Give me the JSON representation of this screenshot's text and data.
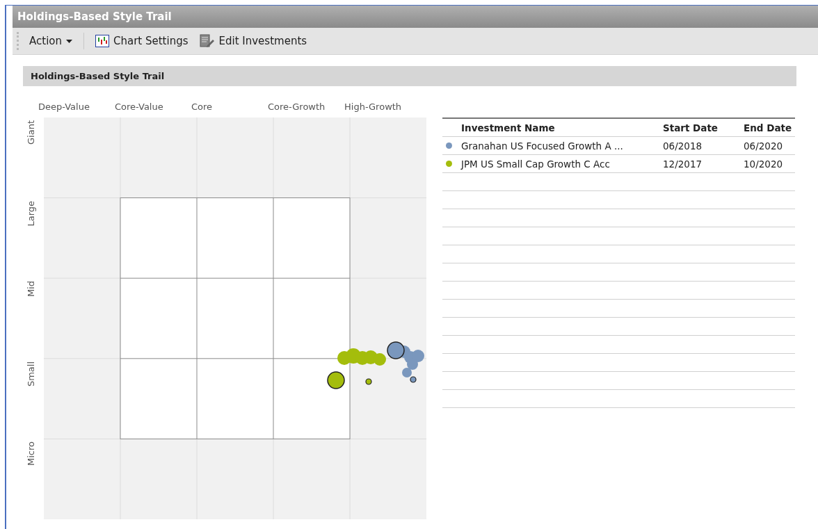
{
  "window": {
    "title": "Holdings-Based Style Trail"
  },
  "toolbar": [
    {
      "kind": "menu",
      "label": "Action"
    },
    {
      "kind": "chart",
      "label": "Chart Settings"
    },
    {
      "kind": "edit",
      "label": "Edit Investments"
    }
  ],
  "section": {
    "title": "Holdings-Based Style Trail"
  },
  "style_map": {
    "columns": [
      "Deep-Value",
      "Core-Value",
      "Core",
      "Core-Growth",
      "High-Growth"
    ],
    "rows": [
      "Giant",
      "Large",
      "Mid",
      "Small",
      "Micro"
    ]
  },
  "table": {
    "columns": [
      "Investment Name",
      "Start Date",
      "End Date"
    ],
    "rows": [
      {
        "color": "#7a97bd",
        "name": "Granahan US Focused Growth A ...",
        "start": "06/2018",
        "end": "06/2020"
      },
      {
        "color": "#a4bd0c",
        "name": "JPM US Small Cap Growth C Acc",
        "start": "12/2017",
        "end": "10/2020"
      }
    ]
  }
}
